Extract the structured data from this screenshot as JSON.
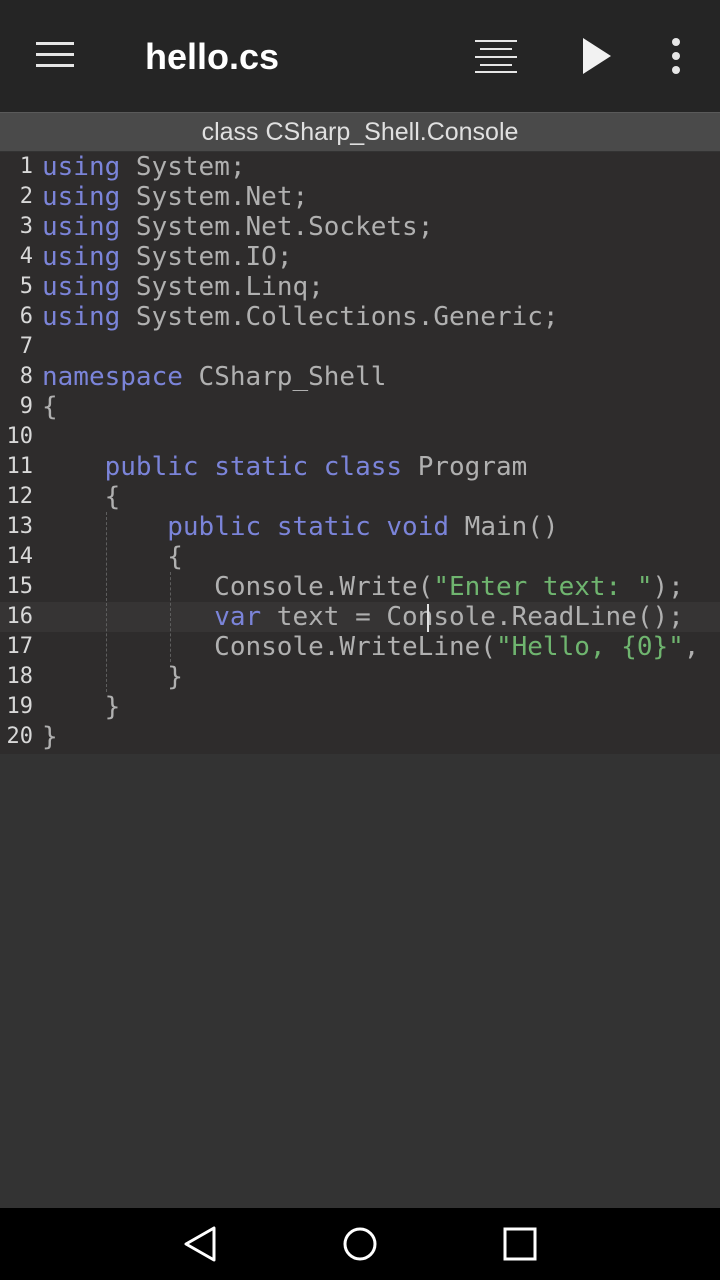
{
  "appbar": {
    "title": "hello.cs",
    "icons": [
      "menu-icon",
      "format-icon",
      "run-icon",
      "more-vert-icon"
    ]
  },
  "classbar": {
    "text": "class CSharp_Shell.Console"
  },
  "editor": {
    "current_line": 16,
    "lines": [
      {
        "num": "1",
        "tokens": [
          {
            "t": "using",
            "k": "kw"
          },
          {
            "t": " System;",
            "k": "id"
          }
        ]
      },
      {
        "num": "2",
        "tokens": [
          {
            "t": "using",
            "k": "kw"
          },
          {
            "t": " System.Net;",
            "k": "id"
          }
        ]
      },
      {
        "num": "3",
        "tokens": [
          {
            "t": "using",
            "k": "kw"
          },
          {
            "t": " System.Net.Sockets;",
            "k": "id"
          }
        ]
      },
      {
        "num": "4",
        "tokens": [
          {
            "t": "using",
            "k": "kw"
          },
          {
            "t": " System.IO;",
            "k": "id"
          }
        ]
      },
      {
        "num": "5",
        "tokens": [
          {
            "t": "using",
            "k": "kw"
          },
          {
            "t": " System.Linq;",
            "k": "id"
          }
        ]
      },
      {
        "num": "6",
        "tokens": [
          {
            "t": "using",
            "k": "kw"
          },
          {
            "t": " System.Collections.Generic;",
            "k": "id"
          }
        ]
      },
      {
        "num": "7",
        "tokens": []
      },
      {
        "num": "8",
        "tokens": [
          {
            "t": "namespace",
            "k": "kw"
          },
          {
            "t": " CSharp_Shell",
            "k": "id"
          }
        ]
      },
      {
        "num": "9",
        "tokens": [
          {
            "t": "{",
            "k": "id"
          }
        ]
      },
      {
        "num": "10",
        "tokens": []
      },
      {
        "num": "11",
        "tokens": [
          {
            "t": "    ",
            "k": "id"
          },
          {
            "t": "public",
            "k": "kw"
          },
          {
            "t": " ",
            "k": "id"
          },
          {
            "t": "static",
            "k": "kw"
          },
          {
            "t": " ",
            "k": "id"
          },
          {
            "t": "class",
            "k": "kw"
          },
          {
            "t": " Program",
            "k": "id"
          }
        ]
      },
      {
        "num": "12",
        "tokens": [
          {
            "t": "    {",
            "k": "id"
          }
        ]
      },
      {
        "num": "13",
        "tokens": [
          {
            "t": "        ",
            "k": "id"
          },
          {
            "t": "public",
            "k": "kw"
          },
          {
            "t": " ",
            "k": "id"
          },
          {
            "t": "static",
            "k": "kw"
          },
          {
            "t": " ",
            "k": "id"
          },
          {
            "t": "void",
            "k": "kw"
          },
          {
            "t": " Main()",
            "k": "id"
          }
        ]
      },
      {
        "num": "14",
        "tokens": [
          {
            "t": "        {",
            "k": "id"
          }
        ]
      },
      {
        "num": "15",
        "tokens": [
          {
            "t": "           Console.Write(",
            "k": "id"
          },
          {
            "t": "\"Enter text: \"",
            "k": "str"
          },
          {
            "t": ");",
            "k": "id"
          }
        ]
      },
      {
        "num": "16",
        "tokens": [
          {
            "t": "           ",
            "k": "id"
          },
          {
            "t": "var",
            "k": "kw"
          },
          {
            "t": " text = Console.ReadLine();",
            "k": "id"
          }
        ]
      },
      {
        "num": "17",
        "tokens": [
          {
            "t": "           Console.WriteLine(",
            "k": "id"
          },
          {
            "t": "\"Hello, {0}\"",
            "k": "str"
          },
          {
            "t": ",",
            "k": "id"
          }
        ]
      },
      {
        "num": "18",
        "tokens": [
          {
            "t": "        }",
            "k": "id"
          }
        ]
      },
      {
        "num": "19",
        "tokens": [
          {
            "t": "    }",
            "k": "id"
          }
        ]
      },
      {
        "num": "20",
        "tokens": [
          {
            "t": "}",
            "k": "id"
          }
        ]
      }
    ]
  },
  "colors": {
    "keyword": "#7b84d9",
    "string": "#6fb56f",
    "identifier": "#b0b0b0",
    "editor_bg": "#2e2c2c",
    "appbar_bg": "#252525"
  },
  "navbar": {
    "icons": [
      "back-icon",
      "home-icon",
      "recents-icon"
    ]
  }
}
